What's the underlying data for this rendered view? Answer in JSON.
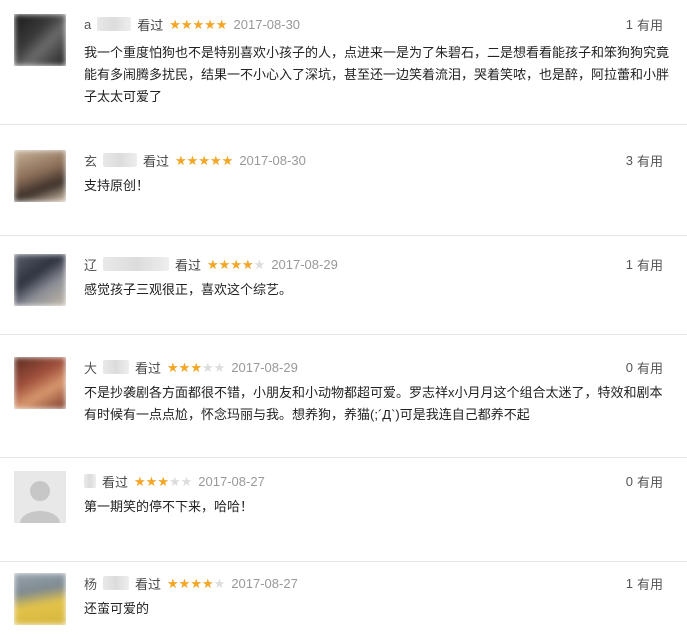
{
  "reviews": [
    {
      "username": "a",
      "watched": "看过",
      "rating": 5,
      "date": "2017-08-30",
      "useful_count": "1",
      "useful_label": "有用",
      "comment": "我一个重度怕狗也不是特别喜欢小孩子的人，点进来一是为了朱碧石，二是想看看能孩子和笨狗狗究竟能有多闹腾多扰民，结果一不小心入了深坑，甚至还一边笑着流泪，哭着笑哝，也是醉，阿拉蕾和小胖子太太可爱了"
    },
    {
      "username": "玄",
      "watched": "看过",
      "rating": 5,
      "date": "2017-08-30",
      "useful_count": "3",
      "useful_label": "有用",
      "comment": "支持原创！"
    },
    {
      "username": "辽",
      "watched": "看过",
      "rating": 4,
      "date": "2017-08-29",
      "useful_count": "1",
      "useful_label": "有用",
      "comment": "感觉孩子三观很正，喜欢这个综艺。"
    },
    {
      "username": "大",
      "watched": "看过",
      "rating": 3,
      "date": "2017-08-29",
      "useful_count": "0",
      "useful_label": "有用",
      "comment": "不是抄袭剧各方面都很不错，小朋友和小动物都超可爱。罗志祥x小月月这个组合太迷了，特效和剧本有时候有一点点尬，怀念玛丽与我。想养狗，养猫(;´Д`)可是我连自己都养不起"
    },
    {
      "username": "",
      "watched": "看过",
      "rating": 3,
      "date": "2017-08-27",
      "useful_count": "0",
      "useful_label": "有用",
      "comment": "第一期笑的停不下来，哈哈！"
    },
    {
      "username": "杨",
      "watched": "看过",
      "rating": 4,
      "date": "2017-08-27",
      "useful_count": "1",
      "useful_label": "有用",
      "comment": "还蛮可爱的"
    }
  ],
  "colors": {
    "star": "#f5a623",
    "star_empty": "#dcdcdc",
    "divider": "#e6e6e6"
  }
}
